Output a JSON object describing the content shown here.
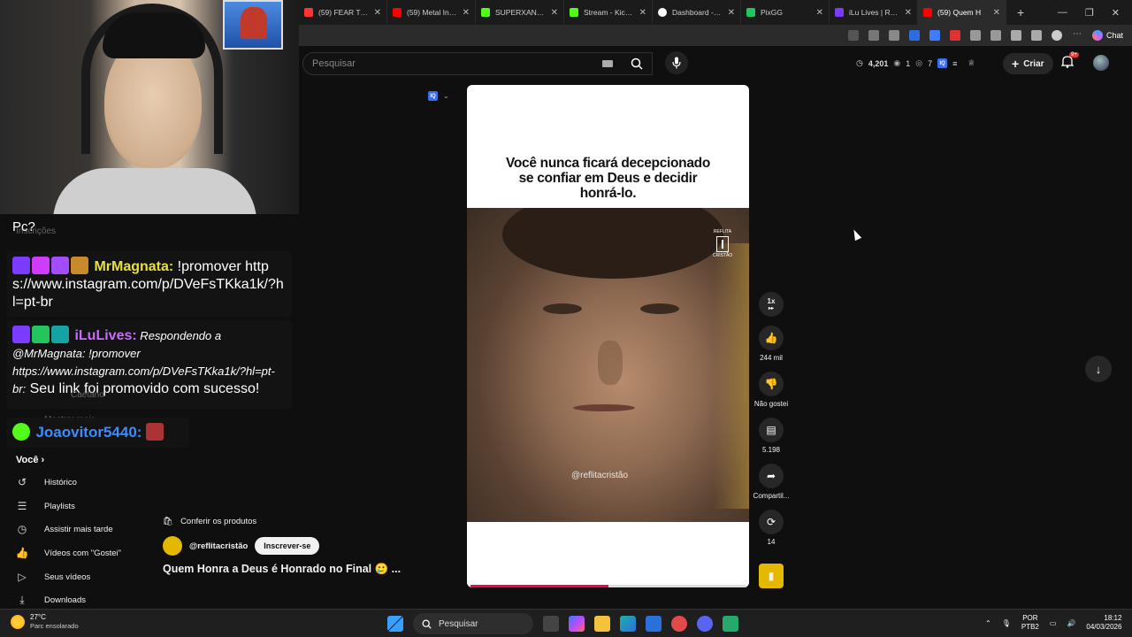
{
  "browser": {
    "tabs": [
      {
        "label": "(59) FEAR THE C",
        "color": "#ff3333"
      },
      {
        "label": "(59) Metal Instru",
        "color": "#ff0000"
      },
      {
        "label": "SUPERXANDAO",
        "color": "#53fc18"
      },
      {
        "label": "Stream - Kick Da",
        "color": "#53fc18"
      },
      {
        "label": "Dashboard - Live",
        "color": "#ffffff"
      },
      {
        "label": "PixGG",
        "color": "#22c55e"
      },
      {
        "label": "iLu Lives | React",
        "color": "#7c3cff"
      },
      {
        "label": "(59) Quem H",
        "color": "#ff0000"
      }
    ],
    "chat_label": "Chat"
  },
  "youtube": {
    "search_placeholder": "Pesquisar",
    "stats": {
      "views": "4,201",
      "a": "1",
      "b": "7"
    },
    "create_label": "Criar",
    "notifications_badge": "9+"
  },
  "left_panel": {
    "ghost_texts": [
      "Inscrições",
      "Mostrar mais",
      "Caetano"
    ],
    "pc_question": "Pc?",
    "chat": [
      {
        "user": "MrMagnata:",
        "user_color": "#e8e03a",
        "text": " !promover https://www.instagram.com/p/DVeFsTKka1k/?hl=pt-br"
      },
      {
        "user": "iLuLives:",
        "user_color": "#c96bff",
        "text_italic": " Respondendo a @MrMagnata: !promover https://www.instagram.com/p/DVeFsTKka1k/?hl=pt-br:",
        "text": " Seu link foi promovido com sucesso!"
      },
      {
        "user": "Joaovitor5440:",
        "user_color": "#3d8bff"
      }
    ],
    "you_label": "Você",
    "items": [
      {
        "label": "Histórico",
        "icon": "history-icon"
      },
      {
        "label": "Playlists",
        "icon": "playlists-icon"
      },
      {
        "label": "Assistir mais tarde",
        "icon": "clock-icon"
      },
      {
        "label": "Vídeos com \"Gostei\"",
        "icon": "like-icon"
      },
      {
        "label": "Seus vídeos",
        "icon": "play-icon"
      },
      {
        "label": "Downloads",
        "icon": "download-icon"
      }
    ]
  },
  "short": {
    "top_text": "Você nunca ficará decepcionado se confiar em Deus e decidir honrá-lo.",
    "watermark": "@reflitacristão",
    "logo_text_top": "REFLITA",
    "logo_text_bottom": "CRISTÃO",
    "progress": 0.5,
    "speed": "1x",
    "likes": "244 mil",
    "dislike_label": "Não gostei",
    "comments": "5.198",
    "share_label": "Compartil...",
    "remix_count": "14",
    "products_label": "Conferir os produtos",
    "channel": "@reflitacristão",
    "subscribe_label": "Inscrever-se",
    "caption": "Quem Honra a Deus é Honrado no Final 🥲 ..."
  },
  "taskbar": {
    "temp": "27°C",
    "weather": "Parc ensolarado",
    "search": "Pesquisar",
    "lang": "POR",
    "layout": "PTB2",
    "time": "18:12",
    "date": "04/03/2026"
  }
}
